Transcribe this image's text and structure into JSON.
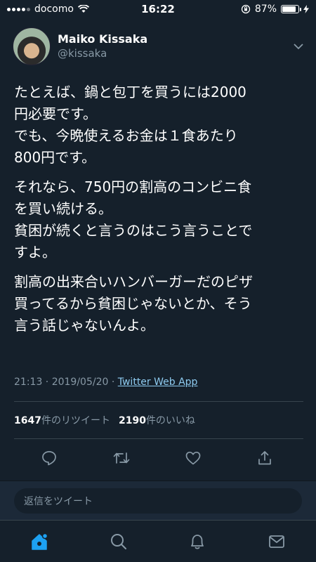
{
  "status_bar": {
    "carrier": "docomo",
    "time": "16:22",
    "battery_percent": "87%",
    "battery_level": 0.87
  },
  "tweet": {
    "display_name": "Maiko Kissaka",
    "handle": "@kissaka",
    "paragraphs": [
      [
        "たとえば、鍋と包丁を買うには2000",
        "円必要です。",
        "でも、今晩使えるお金は１食あたり",
        "800円です。"
      ],
      [
        "それなら、750円の割高のコンビニ食",
        "を買い続ける。",
        "貧困が続くと言うのはこう言うことで",
        "すよ。"
      ],
      [
        "割高の出来合いハンバーガーだのピザ",
        "買ってるから貧困じゃないとか、そう",
        "言う話じゃないんよ。"
      ]
    ],
    "timestamp": "21:13 · 2019/05/20 · ",
    "source": "Twitter Web App",
    "retweets": "1647",
    "retweets_label": "件のリツイート",
    "likes": "2190",
    "likes_label": "件のいいね"
  },
  "reply": {
    "placeholder": "返信をツイート"
  },
  "icons": {
    "reply": "comment-icon",
    "retweet": "retweet-icon",
    "like": "heart-icon",
    "share": "share-icon",
    "home": "home-icon",
    "search": "search-icon",
    "notifications": "bell-icon",
    "messages": "mail-icon"
  },
  "colors": {
    "background": "#15202b",
    "accent": "#1da1f2",
    "muted": "#8899a6",
    "link": "#8ecbf0"
  }
}
